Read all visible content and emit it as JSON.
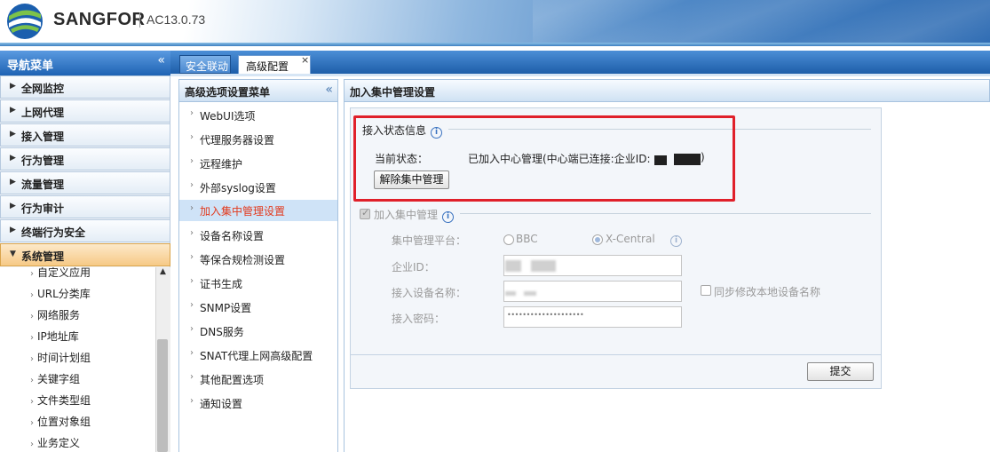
{
  "header": {
    "brand": "SANGFOR",
    "version": "AC13.0.73"
  },
  "nav": {
    "title": "导航菜单",
    "collapse": "«",
    "items": [
      {
        "label": "全网监控",
        "expanded": false
      },
      {
        "label": "上网代理",
        "expanded": false
      },
      {
        "label": "接入管理",
        "expanded": false
      },
      {
        "label": "行为管理",
        "expanded": false
      },
      {
        "label": "流量管理",
        "expanded": false
      },
      {
        "label": "行为审计",
        "expanded": false
      },
      {
        "label": "终端行为安全",
        "expanded": false
      },
      {
        "label": "系统管理",
        "expanded": true
      }
    ],
    "sub_items": [
      "自定义应用",
      "URL分类库",
      "网络服务",
      "IP地址库",
      "时间计划组",
      "关键字组",
      "文件类型组",
      "位置对象组",
      "业务定义"
    ]
  },
  "tabs": [
    {
      "label": "安全联动",
      "active": false
    },
    {
      "label": "高级配置",
      "active": true,
      "close": "×"
    }
  ],
  "middle": {
    "title": "高级选项设置菜单",
    "collapse": "«",
    "items": [
      {
        "label": "WebUI选项"
      },
      {
        "label": "代理服务器设置"
      },
      {
        "label": "远程维护"
      },
      {
        "label": "外部syslog设置"
      },
      {
        "label": "加入集中管理设置",
        "active": true
      },
      {
        "label": "设备名称设置"
      },
      {
        "label": "等保合规检测设置"
      },
      {
        "label": "证书生成"
      },
      {
        "label": "SNMP设置"
      },
      {
        "label": "DNS服务"
      },
      {
        "label": "SNAT代理上网高级配置"
      },
      {
        "label": "其他配置选项"
      },
      {
        "label": "通知设置"
      }
    ]
  },
  "panel": {
    "title": "加入集中管理设置",
    "status_section": {
      "legend": "接入状态信息",
      "status_label": "当前状态：",
      "status_text_prefix": "已加入中心管理(中心端已连接:企业ID:",
      "status_text_suffix": ")",
      "remove_button": "解除集中管理"
    },
    "join_section": {
      "legend": "加入集中管理",
      "checked": true,
      "platform_label": "集中管理平台：",
      "platform_options": [
        {
          "label": "BBC",
          "selected": false
        },
        {
          "label": "X-Central",
          "selected": true
        }
      ],
      "enterprise_id_label": "企业ID：",
      "device_name_label": "接入设备名称：",
      "sync_name_label": "同步修改本地设备名称",
      "password_label": "接入密码：",
      "password_value": "••••••••••••••••••••"
    },
    "submit_button": "提交"
  },
  "colors": {
    "accent": "#1f63b4",
    "active_red": "#e23a1e",
    "highlight_box": "#e0202a"
  },
  "icons": [
    "sangfor-logo-icon",
    "info-icon",
    "triangle-right-icon",
    "triangle-down-icon",
    "chevron-right-icon",
    "close-icon",
    "double-chevron-left-icon",
    "scroll-up-arrow-icon"
  ]
}
